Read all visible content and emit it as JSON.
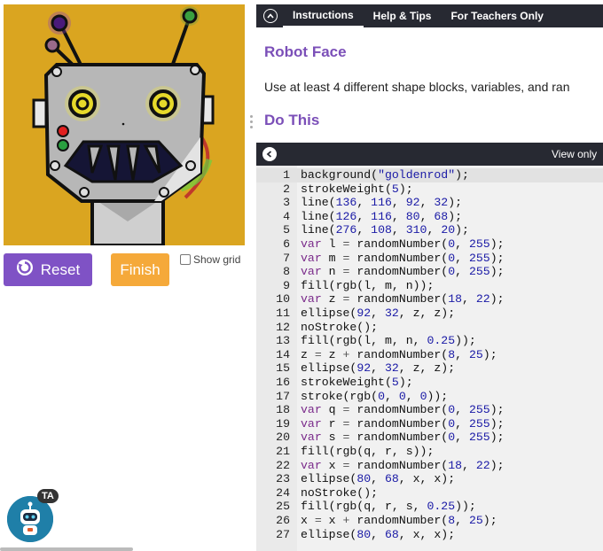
{
  "colors": {
    "canvas_bg": "#daa520",
    "reset_button": "#7f52c5",
    "finish_button": "#f5a93a",
    "heading": "#7b4fb8",
    "tab_bar": "#272932",
    "code_bg": "#f1f1f1",
    "keyword": "#7a2a8a",
    "number": "#1a1aa6"
  },
  "canvas": {
    "icon": "robot-face-drawing"
  },
  "controls": {
    "reset_label": "Reset",
    "reset_icon": "reset-icon",
    "finish_label": "Finish",
    "show_grid_label": "Show grid",
    "show_grid_checked": false
  },
  "assistant": {
    "badge": "TA",
    "icon": "ta-robot-icon"
  },
  "instructions": {
    "tabs": [
      "Instructions",
      "Help & Tips",
      "For Teachers Only"
    ],
    "active_tab": "Instructions",
    "title": "Robot Face",
    "body": "Use at least 4 different shape blocks, variables, and ran",
    "do_this": "Do This"
  },
  "editor": {
    "view_only_label": "View only",
    "current_line": 1,
    "lines": [
      "background(\"goldenrod\");",
      "strokeWeight(5);",
      "line(136, 116, 92, 32);",
      "line(126, 116, 80, 68);",
      "line(276, 108, 310, 20);",
      "var l = randomNumber(0, 255);",
      "var m = randomNumber(0, 255);",
      "var n = randomNumber(0, 255);",
      "fill(rgb(l, m, n));",
      "var z = randomNumber(18, 22);",
      "ellipse(92, 32, z, z);",
      "noStroke();",
      "fill(rgb(l, m, n, 0.25));",
      "z = z + randomNumber(8, 25);",
      "ellipse(92, 32, z, z);",
      "strokeWeight(5);",
      "stroke(rgb(0, 0, 0));",
      "var q = randomNumber(0, 255);",
      "var r = randomNumber(0, 255);",
      "var s = randomNumber(0, 255);",
      "fill(rgb(q, r, s));",
      "var x = randomNumber(18, 22);",
      "ellipse(80, 68, x, x);",
      "noStroke();",
      "fill(rgb(q, r, s, 0.25));",
      "x = x + randomNumber(8, 25);",
      "ellipse(80, 68, x, x);"
    ]
  }
}
